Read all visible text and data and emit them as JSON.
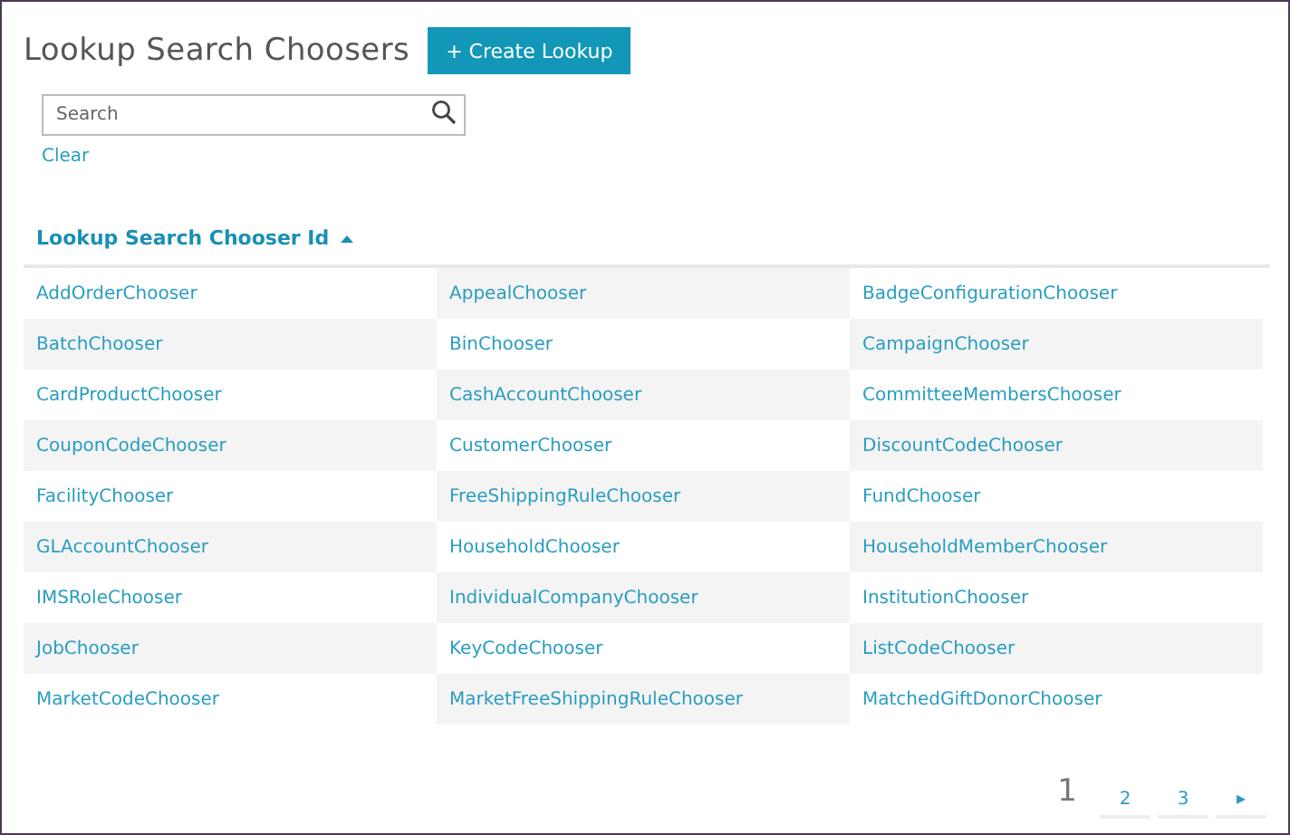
{
  "title": "Lookup Search Choosers",
  "create_button": "+ Create Lookup",
  "search": {
    "placeholder": "Search"
  },
  "clear_link": "Clear",
  "table": {
    "header": {
      "label": "Lookup Search Chooser Id",
      "sorted": true
    },
    "rows": [
      [
        "AddOrderChooser",
        "AppealChooser",
        "BadgeConfigurationChooser"
      ],
      [
        "BatchChooser",
        "BinChooser",
        "CampaignChooser"
      ],
      [
        "CardProductChooser",
        "CashAccountChooser",
        "CommitteeMembersChooser"
      ],
      [
        "CouponCodeChooser",
        "CustomerChooser",
        "DiscountCodeChooser"
      ],
      [
        "FacilityChooser",
        "FreeShippingRuleChooser",
        "FundChooser"
      ],
      [
        "GLAccountChooser",
        "HouseholdChooser",
        "HouseholdMemberChooser"
      ],
      [
        "IMSRoleChooser",
        "IndividualCompanyChooser",
        "InstitutionChooser"
      ],
      [
        "JobChooser",
        "KeyCodeChooser",
        "ListCodeChooser"
      ],
      [
        "MarketCodeChooser",
        "MarketFreeShippingRuleChooser",
        "MatchedGiftDonorChooser"
      ]
    ]
  },
  "pagination": [
    {
      "label": "1",
      "selected": true
    },
    {
      "label": "2",
      "selected": false
    },
    {
      "label": "3",
      "selected": false
    },
    {
      "label": "▸",
      "selected": false
    }
  ]
}
